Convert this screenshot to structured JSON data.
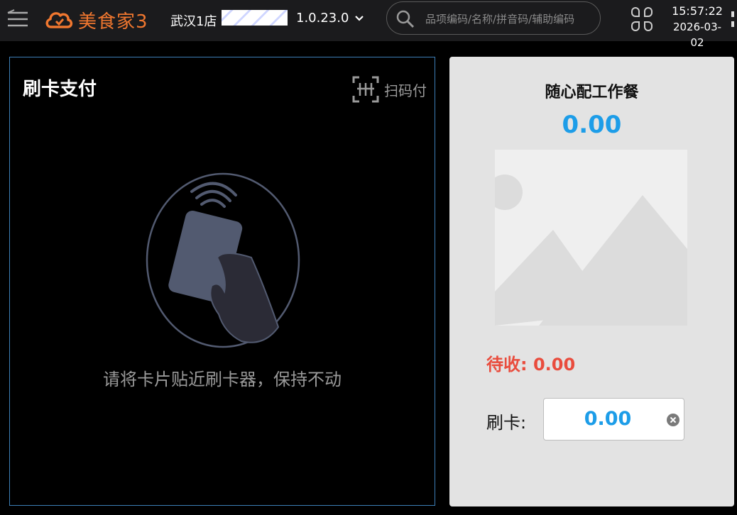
{
  "header": {
    "brand": "美食家3",
    "store": "武汉1店",
    "version": "1.0.23.0",
    "search_placeholder": "品项编码/名称/拼音码/辅助编码",
    "time": "15:57:22",
    "date": "2026-03-02",
    "brand_color": "#f0772f"
  },
  "payment": {
    "title": "刷卡支付",
    "scan_label": "扫码付",
    "hint": "请将卡片贴近刷卡器，保持不动"
  },
  "order": {
    "item_name": "随心配工作餐",
    "item_price": "0.00",
    "pending_label": "待收:",
    "pending_amount": "0.00",
    "card_label": "刷卡:",
    "card_amount": "0.00",
    "accent_color": "#1d9de8",
    "pending_color": "#e94c3d"
  }
}
